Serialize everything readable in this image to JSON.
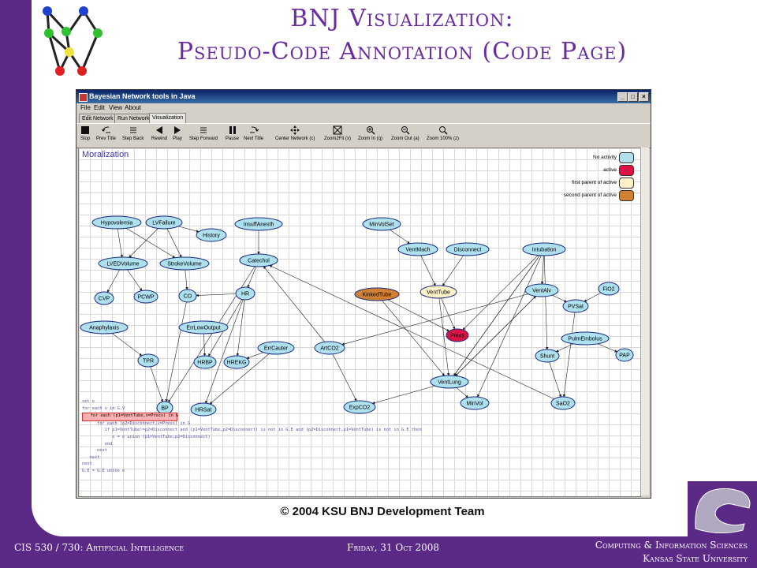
{
  "slide": {
    "title_line1": "BNJ Visualization:",
    "title_line2": "Pseudo-Code Annotation (Code Page)",
    "copyright": "© 2004 KSU BNJ Development Team"
  },
  "footer": {
    "course": "CIS 530 / 730: Artificial Intelligence",
    "date": "Friday, 31 Oct 2008",
    "dept": "Computing & Information Sciences",
    "university": "Kansas State University"
  },
  "window": {
    "title": "Bayesian Network tools in Java",
    "minimize": "_",
    "maximize": "□",
    "close": "×"
  },
  "menu": [
    "File",
    "Edit",
    "View",
    "About"
  ],
  "tabs": [
    "Edit Network",
    "Run Network",
    "Visualization"
  ],
  "toolbar": [
    "Stop",
    "Prev Title",
    "Step Back",
    "Rewind",
    "Play",
    "Step Forward",
    "Pause",
    "Next Title",
    "Center Network (c)",
    "Zoom2Fit (x)",
    "Zoom In (q)",
    "Zoom Out (a)",
    "Zoom 100% (z)"
  ],
  "canvas": {
    "heading": "Moralization",
    "legend": [
      {
        "label": "No activity",
        "color": "#aee0ee"
      },
      {
        "label": "active",
        "color": "#dd1144"
      },
      {
        "label": "first parent of active",
        "color": "#fff2c8"
      },
      {
        "label": "second parent of active",
        "color": "#d08030"
      }
    ],
    "nodes": {
      "Hypovolemia": "Hypovolemia",
      "LVFailure": "LVFailure",
      "History": "History",
      "InsuffAnesth": "InsuffAnesth",
      "MinVolSet": "MinVolSet",
      "LVEDVolume": "LVEDVolume",
      "StrokeVolume": "StrokeVolume",
      "Catechol": "Catechol",
      "VentMach": "VentMach",
      "Disconnect": "Disconnect",
      "Intubation": "Intubation",
      "CVP": "CVP",
      "PCWP": "PCWP",
      "CO": "CO",
      "HR": "HR",
      "KinkedTube": "KinkedTube",
      "VentTube": "VentTube",
      "VentAlv": "VentAlv",
      "FiO2": "FiO2",
      "PVSat": "PVSat",
      "Anaphylaxis": "Anaphylaxis",
      "ErrLowOutput": "ErrLowOutput",
      "Press": "Press",
      "PulmEmbolus": "PulmEmbolus",
      "ErrCauter": "ErrCauter",
      "ArtCO2": "ArtCO2",
      "TPR": "TPR",
      "HRBP": "HRBP",
      "HREKG": "HREKG",
      "Shunt": "Shunt",
      "PAP": "PAP",
      "VentLung": "VentLung",
      "BP": "BP",
      "HRSat": "HRSat",
      "ExpCO2": "ExpCO2",
      "MinVol": "MinVol",
      "SaO2": "SaO2"
    },
    "code": [
      "set e",
      "for each v in G.V",
      "   for each (p1=VentTube,v=Press) in G",
      "      for each (p2=Disconnect,v=Press) in G",
      "         if p1=VentTube!=p2=Disconnect and (p1=VentTube,p2=Disconnect) is not in G.E and (p2=Disconnect,p1=VentTube) is not in G.E then",
      "            e = e union (p1=VentTube,p2=Disconnect)",
      "         end",
      "      next",
      "   next",
      "next",
      "G.E = G.E union e"
    ]
  }
}
